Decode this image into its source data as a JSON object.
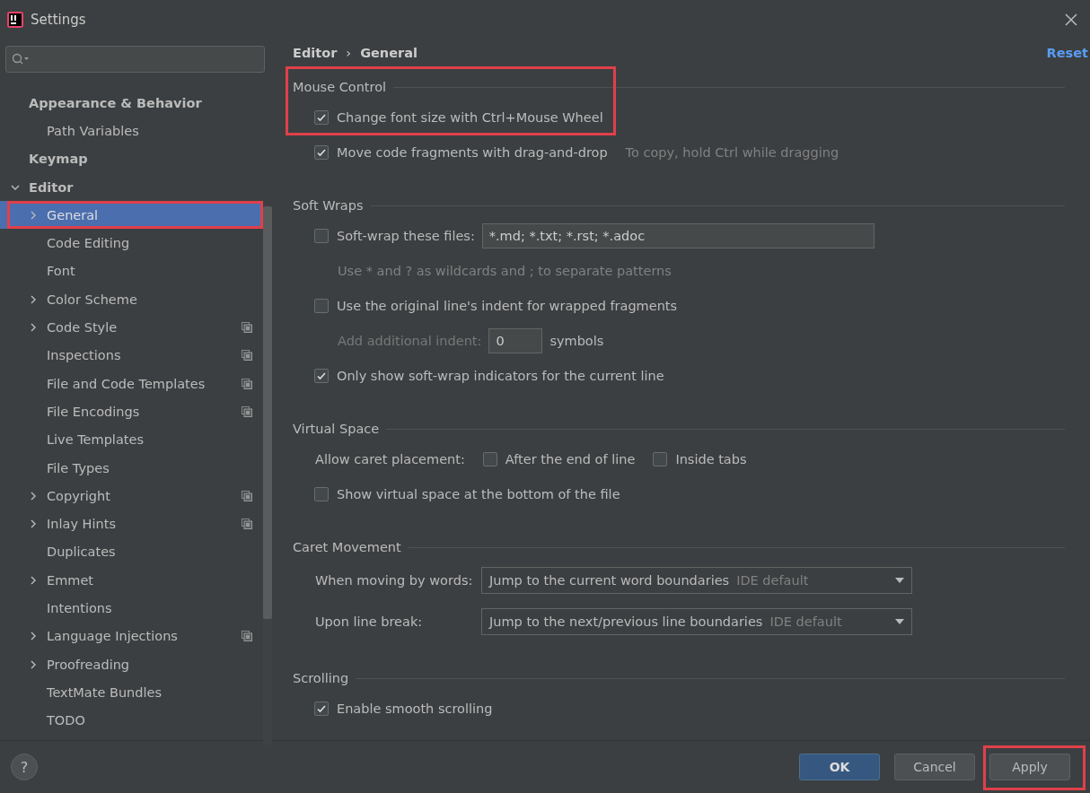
{
  "window": {
    "title": "Settings"
  },
  "sidebar": {
    "items": [
      {
        "label": "Appearance & Behavior",
        "bold": true,
        "selected": false,
        "shared": false,
        "highlighted": false,
        "children": [
          {
            "label": "Path Variables",
            "bold": false,
            "selected": false,
            "shared": false,
            "highlighted": false
          }
        ]
      },
      {
        "label": "Keymap",
        "bold": true,
        "selected": false,
        "shared": false,
        "highlighted": false
      },
      {
        "label": "Editor",
        "bold": true,
        "expanded": true,
        "selected": false,
        "shared": false,
        "highlighted": false,
        "children": [
          {
            "label": "General",
            "bold": false,
            "expanded": false,
            "selected": true,
            "shared": false,
            "highlighted": true
          },
          {
            "label": "Code Editing",
            "bold": false,
            "selected": false,
            "shared": false,
            "highlighted": false
          },
          {
            "label": "Font",
            "bold": false,
            "selected": false,
            "shared": false,
            "highlighted": false
          },
          {
            "label": "Color Scheme",
            "bold": false,
            "expanded": false,
            "selected": false,
            "shared": false,
            "highlighted": false
          },
          {
            "label": "Code Style",
            "bold": false,
            "expanded": false,
            "selected": false,
            "shared": true,
            "highlighted": false
          },
          {
            "label": "Inspections",
            "bold": false,
            "selected": false,
            "shared": true,
            "highlighted": false
          },
          {
            "label": "File and Code Templates",
            "bold": false,
            "selected": false,
            "shared": true,
            "highlighted": false
          },
          {
            "label": "File Encodings",
            "bold": false,
            "selected": false,
            "shared": true,
            "highlighted": false
          },
          {
            "label": "Live Templates",
            "bold": false,
            "selected": false,
            "shared": false,
            "highlighted": false
          },
          {
            "label": "File Types",
            "bold": false,
            "selected": false,
            "shared": false,
            "highlighted": false
          },
          {
            "label": "Copyright",
            "bold": false,
            "expanded": false,
            "selected": false,
            "shared": true,
            "highlighted": false
          },
          {
            "label": "Inlay Hints",
            "bold": false,
            "expanded": false,
            "selected": false,
            "shared": true,
            "highlighted": false
          },
          {
            "label": "Duplicates",
            "bold": false,
            "selected": false,
            "shared": false,
            "highlighted": false
          },
          {
            "label": "Emmet",
            "bold": false,
            "expanded": false,
            "selected": false,
            "shared": false,
            "highlighted": false
          },
          {
            "label": "Intentions",
            "bold": false,
            "selected": false,
            "shared": false,
            "highlighted": false
          },
          {
            "label": "Language Injections",
            "bold": false,
            "expanded": false,
            "selected": false,
            "shared": true,
            "highlighted": false
          },
          {
            "label": "Proofreading",
            "bold": false,
            "expanded": false,
            "selected": false,
            "shared": false,
            "highlighted": false
          },
          {
            "label": "TextMate Bundles",
            "bold": false,
            "selected": false,
            "shared": false,
            "highlighted": false
          },
          {
            "label": "TODO",
            "bold": false,
            "selected": false,
            "shared": false,
            "highlighted": false
          }
        ]
      }
    ]
  },
  "breadcrumb": {
    "items": [
      "Editor",
      "General"
    ],
    "separator": "›"
  },
  "reset_link": "Reset",
  "sections": [
    {
      "title": "Mouse Control",
      "rows": [
        {
          "kind": "checkbox",
          "label": "Change font size with Ctrl+Mouse Wheel",
          "checked": true,
          "highlighted": true
        },
        {
          "kind": "checkbox",
          "label": "Move code fragments with drag-and-drop",
          "checked": true,
          "highlighted": false,
          "hint": "To copy, hold Ctrl while dragging"
        }
      ]
    },
    {
      "title": "Soft Wraps",
      "rows": [
        {
          "kind": "checkbox-field",
          "label": "Soft-wrap these files:",
          "checked": false,
          "value": "*.md; *.txt; *.rst; *.adoc"
        },
        {
          "kind": "hint",
          "text": "Use * and ? as wildcards and ; to separate patterns"
        },
        {
          "kind": "checkbox",
          "label": "Use the original line's indent for wrapped fragments",
          "checked": false,
          "highlighted": false
        },
        {
          "kind": "number-field",
          "label": "Add additional indent:",
          "value": "0",
          "unit": "symbols",
          "disabled": true
        },
        {
          "kind": "checkbox",
          "label": "Only show soft-wrap indicators for the current line",
          "checked": true,
          "highlighted": false
        }
      ]
    },
    {
      "title": "Virtual Space",
      "rows": [
        {
          "kind": "option-group",
          "label": "Allow caret placement:",
          "options": [
            {
              "label": "After the end of line",
              "checked": false
            },
            {
              "label": "Inside tabs",
              "checked": false
            }
          ]
        },
        {
          "kind": "checkbox",
          "label": "Show virtual space at the bottom of the file",
          "checked": false,
          "highlighted": false
        }
      ]
    },
    {
      "title": "Caret Movement",
      "rows": [
        {
          "kind": "dropdown",
          "label": "When moving by words:",
          "value": "Jump to the current word boundaries",
          "note": "IDE default"
        },
        {
          "kind": "dropdown",
          "label": "Upon line break:",
          "value": "Jump to the next/previous line boundaries",
          "note": "IDE default"
        }
      ]
    },
    {
      "title": "Scrolling",
      "rows": [
        {
          "kind": "checkbox",
          "label": "Enable smooth scrolling",
          "checked": true,
          "highlighted": false
        }
      ]
    }
  ],
  "footer": {
    "help": "?",
    "buttons": [
      {
        "label": "OK",
        "primary": true,
        "highlighted": false
      },
      {
        "label": "Cancel",
        "primary": false,
        "highlighted": false
      },
      {
        "label": "Apply",
        "primary": false,
        "highlighted": true
      }
    ]
  }
}
